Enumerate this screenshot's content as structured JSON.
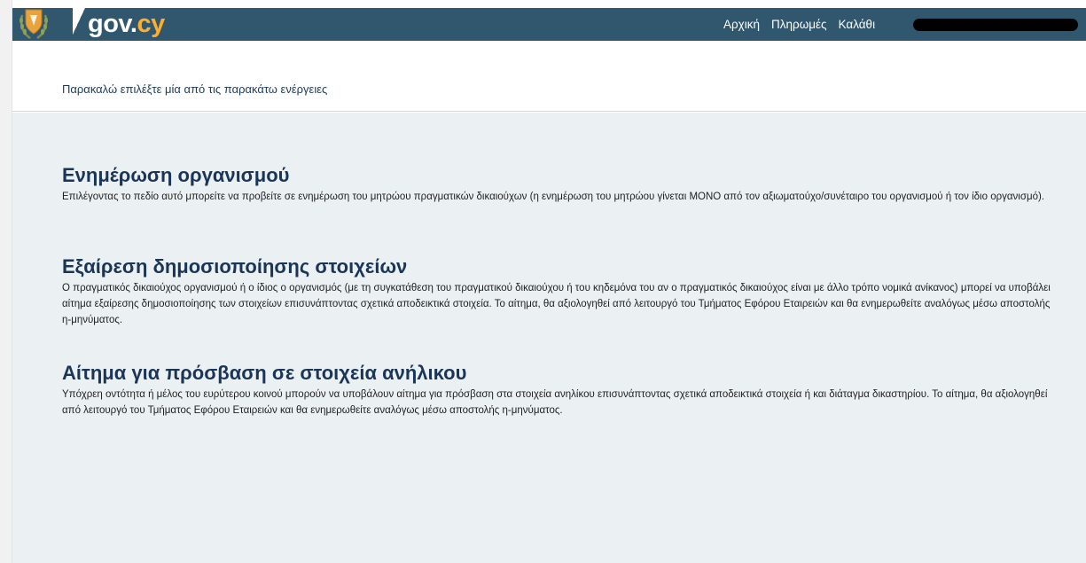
{
  "header": {
    "brand_main": "gov.",
    "brand_accent": "cy",
    "nav": [
      "Αρχική",
      "Πληρωμές",
      "Καλάθι"
    ]
  },
  "subheader": {
    "instruction": "Παρακαλώ επιλέξτε μία από τις παρακάτω ενέργειες"
  },
  "sections": [
    {
      "title": "Ενημέρωση οργανισμού",
      "description": "Επιλέγοντας το πεδίο αυτό μπορείτε να προβείτε σε ενημέρωση του μητρώου πραγματικών δικαιούχων (η ενημέρωση του μητρώου γίνεται ΜΟΝΟ από τον αξιωματούχο/συνέταιρο του οργανισμού ή τον ίδιο οργανισμό)."
    },
    {
      "title": "Εξαίρεση δημοσιοποίησης στοιχείων",
      "description": "Ο πραγματικός δικαιούχος οργανισμού ή ο ίδιος ο οργανισμός (με τη συγκατάθεση του πραγματικού δικαιούχου ή του κηδεμόνα του αν ο πραγματικός δικαιούχος είναι με άλλο τρόπο νομικά ανίκανος) μπορεί να υποβάλει αίτημα εξαίρεσης δημοσιοποίησης των στοιχείων επισυνάπτοντας σχετικά αποδεικτικά στοιχεία. Το αίτημα, θα αξιολογηθεί από λειτουργό του Τμήματος Εφόρου Εταιρειών και θα ενημερωθείτε αναλόγως μέσω αποστολής η-μηνύματος."
    },
    {
      "title": "Αίτημα για πρόσβαση σε στοιχεία ανήλικου",
      "description": "Υπόχρεη οντότητα ή μέλος του ευρύτερου κοινού μπορούν να υποβάλουν αίτημα για πρόσβαση στα στοιχεία ανηλίκου επισυνάπτοντας σχετικά αποδεικτικά στοιχεία ή και διάταγμα δικαστηρίου. Το αίτημα, θα αξιολογηθεί από λειτουργό του Τμήματος Εφόρου Εταιρειών και θα ενημερωθείτε αναλόγως μέσω αποστολής η-μηνύματος."
    }
  ],
  "colors": {
    "header_bg": "#31576f",
    "brand_accent": "#ffad2d",
    "heading": "#1b3557",
    "main_bg": "#ebf1f3"
  },
  "icons": {
    "emblem": "cyprus-coat-of-arms-icon"
  }
}
